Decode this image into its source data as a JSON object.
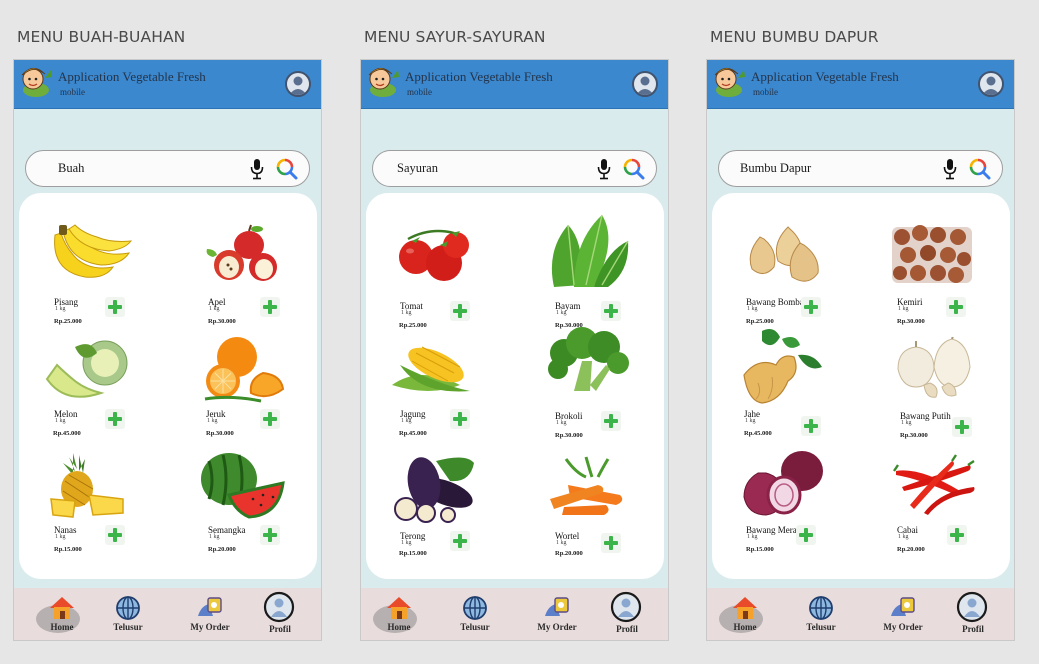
{
  "screens": [
    {
      "section_title": "MENU BUAH-BUAHAN",
      "app_title": "Application Vegetable Fresh",
      "app_subtitle": "mobile",
      "search_value": "Buah",
      "products": [
        {
          "name": "Pisang",
          "unit": "1 kg",
          "price": "Rp.25.000",
          "image": "banana"
        },
        {
          "name": "Apel",
          "unit": "1 kg",
          "price": "Rp.30.000",
          "image": "apple"
        },
        {
          "name": "Melon",
          "unit": "1 kg",
          "price": "Rp.45.000",
          "image": "melon"
        },
        {
          "name": "Jeruk",
          "unit": "1 kg",
          "price": "Rp.30.000",
          "image": "orange"
        },
        {
          "name": "Nanas",
          "unit": "1 kg",
          "price": "Rp.15.000",
          "image": "pineapple"
        },
        {
          "name": "Semangka",
          "unit": "1 kg",
          "price": "Rp.20.000",
          "image": "watermelon"
        }
      ]
    },
    {
      "section_title": "MENU SAYUR-SAYURAN",
      "app_title": "Application Vegetable Fresh",
      "app_subtitle": "mobile",
      "search_value": "Sayuran",
      "products": [
        {
          "name": "Tomat",
          "unit": "1 kg",
          "price": "Rp.25.000",
          "image": "tomato"
        },
        {
          "name": "Bayam",
          "unit": "1 kg",
          "price": "Rp.30.000",
          "image": "spinach"
        },
        {
          "name": "Jagung",
          "unit": "1 kg",
          "price": "Rp.45.000",
          "image": "corn"
        },
        {
          "name": "Brokoli",
          "unit": "1 kg",
          "price": "Rp.30.000",
          "image": "broccoli"
        },
        {
          "name": "Terong",
          "unit": "1 kg",
          "price": "Rp.15.000",
          "image": "eggplant"
        },
        {
          "name": "Wortel",
          "unit": "1 kg",
          "price": "Rp.20.000",
          "image": "carrot"
        }
      ]
    },
    {
      "section_title": "MENU BUMBU DAPUR",
      "app_title": "Application Vegetable Fresh",
      "app_subtitle": "mobile",
      "search_value": "Bumbu Dapur",
      "products": [
        {
          "name": "Bawang Bombai",
          "unit": "1 kg",
          "price": "Rp.25.000",
          "image": "onion"
        },
        {
          "name": "Kemiri",
          "unit": "1 kg",
          "price": "Rp.30.000",
          "image": "candlenut"
        },
        {
          "name": "Jahe",
          "unit": "1 kg",
          "price": "Rp.45.000",
          "image": "ginger"
        },
        {
          "name": "Bawang Putih",
          "unit": "1 kg",
          "price": "Rp.30.000",
          "image": "garlic"
        },
        {
          "name": "Bawang Merah",
          "unit": "1 kg",
          "price": "Rp.15.000",
          "image": "shallot"
        },
        {
          "name": "Cabai",
          "unit": "1 kg",
          "price": "Rp.20.000",
          "image": "chili"
        }
      ]
    }
  ],
  "nav": {
    "home": "Home",
    "browse": "Telusur",
    "orders": "My Order",
    "profile": "Profil"
  },
  "icons": {
    "logo": "farmer-logo-icon",
    "avatar": "user-avatar-icon",
    "mic": "microphone-icon",
    "search": "search-icon",
    "add": "plus-icon",
    "home": "home-icon",
    "browse": "globe-icon",
    "orders": "order-icon",
    "profile": "profile-icon"
  },
  "colors": {
    "appbar": "#3b88cf",
    "background": "#daebee",
    "nav": "#e9dcdc",
    "add_button": "#3bb54a"
  }
}
